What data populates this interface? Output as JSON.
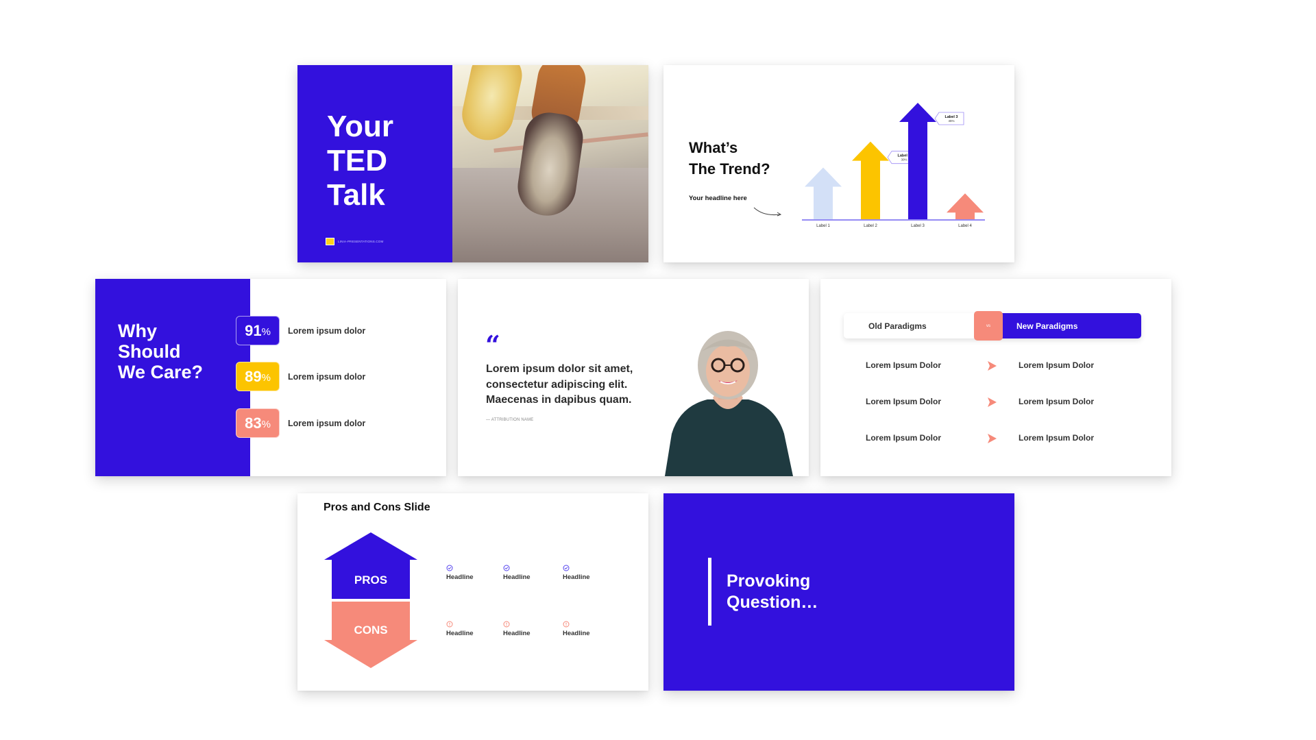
{
  "colors": {
    "brand_blue": "#3311dd",
    "yellow": "#fcc400",
    "coral": "#f68a7a",
    "light_blue": "#d3e0f7",
    "text_dark": "#2b2b2b"
  },
  "slides": {
    "title_slide": {
      "title_lines": [
        "Your",
        "TED",
        "Talk"
      ],
      "logo_text": "LINIA-PRESENTATIONS.COM",
      "image": "runner-feet-photo"
    },
    "trend_slide": {
      "title_lines": [
        "What’s",
        "The Trend?"
      ],
      "subtitle": "Your headline here",
      "chart_data": {
        "type": "bar",
        "style": "arrows",
        "categories": [
          "Label 1",
          "Label 2",
          "Label 3",
          "Label 4"
        ],
        "values": [
          20,
          30,
          45,
          10
        ],
        "colors": [
          "#d3e0f7",
          "#fcc400",
          "#3311dd",
          "#f68a7a"
        ],
        "callouts": [
          {
            "category": "Label 2",
            "title": "Label 2",
            "value": "30%"
          },
          {
            "category": "Label 3",
            "title": "Label 3",
            "value": "45%"
          }
        ],
        "title": "",
        "xlabel": "",
        "ylabel": ""
      }
    },
    "care_slide": {
      "title_lines": [
        "Why",
        "Should",
        "We Care?"
      ],
      "stats": [
        {
          "value": "91",
          "unit": "%",
          "text": "Lorem ipsum dolor",
          "color": "#3311dd"
        },
        {
          "value": "89",
          "unit": "%",
          "text": "Lorem ipsum dolor",
          "color": "#fcc400"
        },
        {
          "value": "83",
          "unit": "%",
          "text": "Lorem ipsum dolor",
          "color": "#f68a7a"
        }
      ]
    },
    "quote_slide": {
      "quote_mark": "“",
      "quote": "Lorem ipsum dolor sit amet, consectetur adipiscing elit. Maecenas in dapibus quam.",
      "attribution": "— ATTRIBUTION NAME",
      "image": "smiling-woman-portrait"
    },
    "paradigm_slide": {
      "old_label": "Old Paradigms",
      "vs_label": "vs",
      "new_label": "New Paradigms",
      "rows": [
        {
          "old": "Lorem Ipsum Dolor",
          "new": "Lorem Ipsum Dolor"
        },
        {
          "old": "Lorem Ipsum Dolor",
          "new": "Lorem Ipsum Dolor"
        },
        {
          "old": "Lorem Ipsum Dolor",
          "new": "Lorem Ipsum Dolor"
        }
      ]
    },
    "pros_cons_slide": {
      "title": "Pros and Cons Slide",
      "pros_label": "PROS",
      "cons_label": "CONS",
      "pros": [
        "Headline",
        "Headline",
        "Headline"
      ],
      "cons": [
        "Headline",
        "Headline",
        "Headline"
      ]
    },
    "question_slide": {
      "title_lines": [
        "Provoking",
        "Question…"
      ]
    }
  }
}
